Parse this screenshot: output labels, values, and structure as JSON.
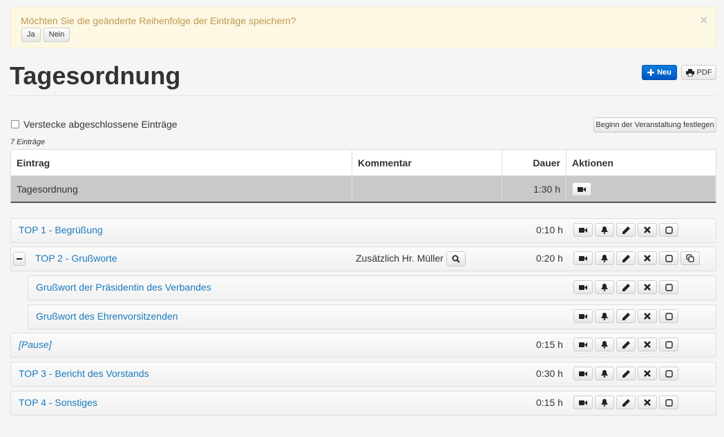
{
  "alert": {
    "message": "Möchten Sie die geänderte Reihenfolge der Einträge speichern?",
    "yes_label": "Ja",
    "no_label": "Nein",
    "close_glyph": "×"
  },
  "header": {
    "title": "Tagesordnung",
    "new_label": "Neu",
    "pdf_label": "PDF"
  },
  "controls": {
    "hide_completed_label": "Verstecke abgeschlossene Einträge",
    "begin_label": "Beginn der Veranstaltung festlegen",
    "count_label": "7 Einträge"
  },
  "table": {
    "columns": [
      "Eintrag",
      "Kommentar",
      "Dauer",
      "Aktionen"
    ],
    "summary_row": {
      "entry": "Tagesordnung",
      "comment": "",
      "duration": "1:30 h"
    }
  },
  "items": [
    {
      "title": "TOP 1 - Begrüßung",
      "comment": "",
      "duration": "0:10 h"
    },
    {
      "title": "TOP 2 - Grußworte",
      "comment": "Zusätzlich Hr. Müller",
      "duration": "0:20 h"
    },
    {
      "title": "Grußwort der Präsidentin des Verbandes",
      "comment": "",
      "duration": ""
    },
    {
      "title": "Grußwort des Ehrenvorsitzenden",
      "comment": "",
      "duration": ""
    },
    {
      "title": "[Pause]",
      "comment": "",
      "duration": "0:15 h"
    },
    {
      "title": "TOP 3 - Bericht des Vorstands",
      "comment": "",
      "duration": "0:30 h"
    },
    {
      "title": "TOP 4 - Sonstiges",
      "comment": "",
      "duration": "0:15 h"
    }
  ],
  "colors": {
    "link": "#1a7bbf",
    "alert_text": "#c09853",
    "alert_bg": "#fcf8e3",
    "primary": "#0055c2"
  },
  "icons": [
    "video-icon",
    "bell-icon",
    "pencil-icon",
    "delete-icon",
    "checkbox-square-icon",
    "copy-icon",
    "search-icon",
    "minus-icon",
    "plus-icon",
    "print-icon"
  ]
}
